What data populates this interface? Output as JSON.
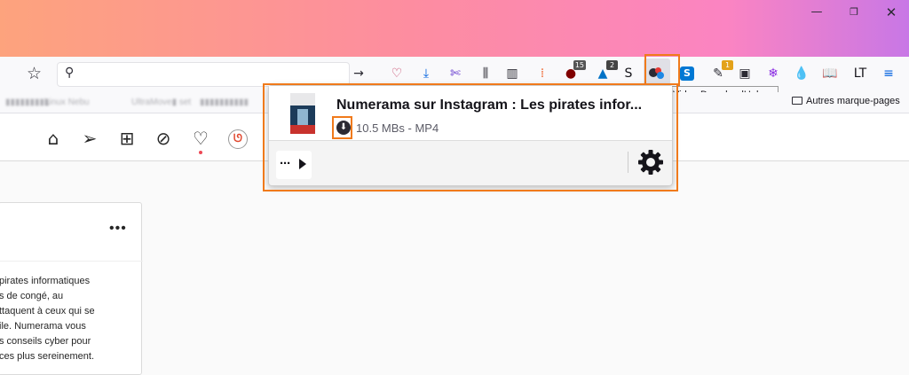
{
  "window": {
    "minimize": "—",
    "maximize": "❐",
    "close": "✕"
  },
  "navbar": {
    "bookmark_icon": "star-icon",
    "search_icon_glyph": "⚲",
    "toolbar_icons": [
      {
        "name": "forward-arrow-icon",
        "glyph": "→",
        "color": "#2b2a33"
      },
      {
        "name": "pocket-icon",
        "glyph": "♡",
        "color": "#c1365c"
      },
      {
        "name": "downloads-icon",
        "glyph": "⤓",
        "color": "#0060df"
      },
      {
        "name": "screenshot-icon",
        "glyph": "✄",
        "color": "#592acb"
      },
      {
        "name": "library-icon",
        "glyph": "⫼",
        "color": "#2b2a33"
      },
      {
        "name": "sidebar-icon",
        "glyph": "▥",
        "color": "#2b2a33"
      },
      {
        "name": "extension-icon",
        "glyph": "⁞",
        "color": "#f06a35"
      },
      {
        "name": "ublock-icon",
        "glyph": "●",
        "color": "#800000",
        "badge": "15",
        "badge_color": "#555"
      },
      {
        "name": "extension-tag-icon",
        "glyph": "▲",
        "color": "#0072c6",
        "badge": "2",
        "badge_color": "#444"
      },
      {
        "name": "s-extension-icon",
        "glyph": "S",
        "color": "#15141a"
      }
    ],
    "right_icons": [
      {
        "name": "skype-icon",
        "glyph": "S",
        "color": "#fff",
        "bg": "#0078d4"
      },
      {
        "name": "pen-extension-icon",
        "glyph": "✎",
        "color": "#2b2a33",
        "badge": "1",
        "badge_color": "#e3a21a"
      },
      {
        "name": "reader-icon",
        "glyph": "▣",
        "color": "#2b2a33"
      },
      {
        "name": "snowflake-icon",
        "glyph": "❄",
        "color": "#8a2be2"
      },
      {
        "name": "drop-icon",
        "glyph": "💧",
        "color": "#0060df"
      },
      {
        "name": "book-icon",
        "glyph": "📖",
        "color": "#555"
      },
      {
        "name": "languagetool-icon",
        "glyph": "LT",
        "color": "#15141a"
      },
      {
        "name": "menu-icon",
        "glyph": "≡",
        "color": "#0060df"
      }
    ],
    "vdh_tooltip": "Video DownloadHelper"
  },
  "bookmarks": {
    "blurred": [
      "▮▮▮▮▮▮▮▮▮",
      "Linux Nebu",
      "UltraMove▮ set",
      "▮▮▮▮▮▮▮▮▮▮",
      "▮▮▮▮▮▮▮▮▮▮▮▮▮"
    ],
    "other": "Autres marque-pages"
  },
  "instagram": {
    "nav_icons": [
      "home-icon",
      "direct-message-icon",
      "new-post-icon",
      "explore-icon",
      "activity-heart-icon"
    ],
    "post_menu": "•••",
    "caption_lines": [
      "pirates informatiques",
      "s de congé, au",
      "ttaquent à ceux qui se",
      "ile. Numerama vous",
      "s conseils cyber pour",
      "ces plus sereinement."
    ]
  },
  "popup": {
    "title": "Numerama sur Instagram : Les pirates infor...",
    "meta": "10.5 MBs - MP4",
    "more_label": "···"
  },
  "accent": "#f07a1b"
}
